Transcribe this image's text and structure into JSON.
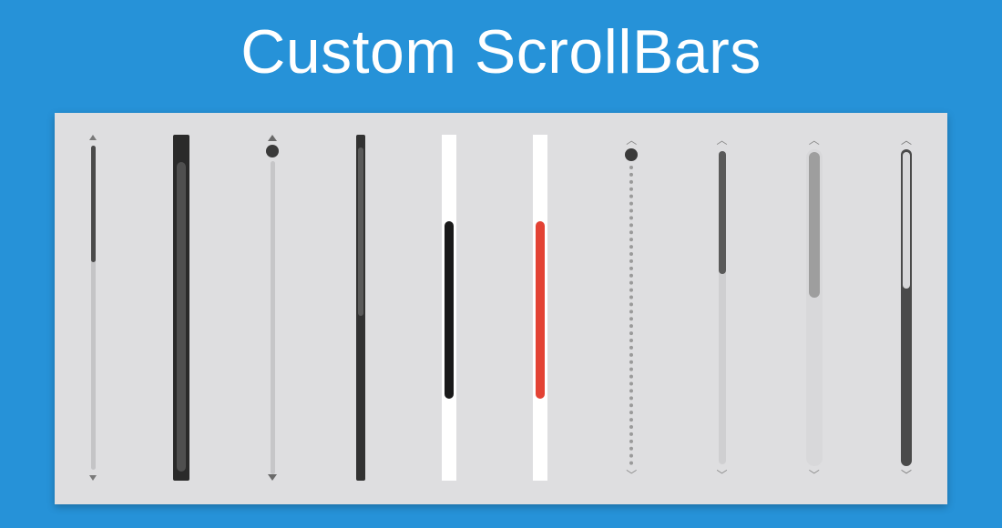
{
  "title": "Custom ScrollBars",
  "colors": {
    "background": "#2692d8",
    "panel": "#dedee0",
    "accent_red": "#e34234",
    "dark": "#2a2a2a",
    "white": "#ffffff"
  },
  "scrollbars": [
    {
      "id": "sb1",
      "style": "thin-arrows",
      "thumb_position": "top",
      "thumb_color": "dark-grey"
    },
    {
      "id": "sb2",
      "style": "wide-dark",
      "thumb_position": "lower",
      "thumb_color": "grey"
    },
    {
      "id": "sb3",
      "style": "thin-arrows-knob",
      "thumb_position": "top-knob",
      "thumb_color": "dark"
    },
    {
      "id": "sb4",
      "style": "narrow-dark",
      "thumb_position": "upper",
      "thumb_color": "grey"
    },
    {
      "id": "sb5",
      "style": "white-track",
      "thumb_position": "center",
      "thumb_color": "black"
    },
    {
      "id": "sb6",
      "style": "white-track",
      "thumb_position": "center",
      "thumb_color": "red"
    },
    {
      "id": "sb7",
      "style": "dotted-chevron-knob",
      "thumb_position": "top-knob",
      "thumb_color": "dark"
    },
    {
      "id": "sb8",
      "style": "light-chevron",
      "thumb_position": "top",
      "thumb_color": "dark-grey"
    },
    {
      "id": "sb9",
      "style": "wide-light-chevron",
      "thumb_position": "top",
      "thumb_color": "grey"
    },
    {
      "id": "sb10",
      "style": "dark-chevron",
      "thumb_position": "top",
      "thumb_color": "light"
    }
  ]
}
